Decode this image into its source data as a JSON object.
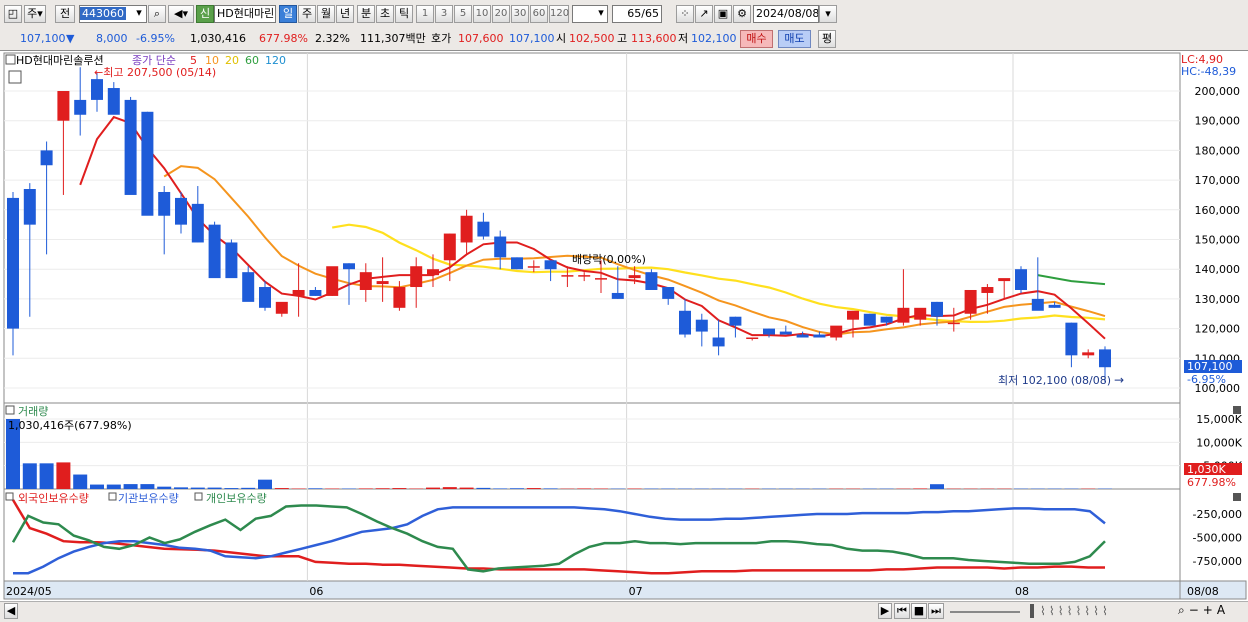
{
  "toolbar": {
    "market": "주",
    "prev_label": "전",
    "code": "443060",
    "name": "HD현대마린",
    "new_badge": "신",
    "periods": [
      "일",
      "주",
      "월",
      "년",
      "분",
      "초",
      "틱"
    ],
    "active_period": "일",
    "intervals": [
      "1",
      "3",
      "5",
      "10",
      "20",
      "30",
      "60",
      "120"
    ],
    "count": "65/65",
    "date": "2024/08/08"
  },
  "quote": {
    "price": "107,100",
    "price_arrow": "▼",
    "change": "8,000",
    "change_pct": "-6.95%",
    "volume": "1,030,416",
    "volume_ratio": "677.98%",
    "turnover_pct": "2.32%",
    "amount": "111,307백만",
    "ask_label": "호가",
    "ask": "107,600",
    "bid": "107,100",
    "open_label": "시",
    "open": "102,500",
    "high_label": "고",
    "high": "113,600",
    "low_label": "저",
    "low": "102,100",
    "buy_label": "매수",
    "sell_label": "매도",
    "eval_label": "평"
  },
  "price_panel": {
    "title": "HD현대마린솔루션",
    "ma_title": "종가 단순",
    "ma_periods": [
      "5",
      "10",
      "20",
      "60",
      "120"
    ],
    "ma_colors": {
      "5": "#e01e1e",
      "10": "#f5951e",
      "20": "#ffd51e",
      "60": "#2e9e3e",
      "120": "#1e8fd0"
    },
    "lc_label": "LC:4,90",
    "hc_label": "HC:-48,39",
    "yticks": [
      {
        "v": 200000,
        "t": "200,000"
      },
      {
        "v": 190000,
        "t": "190,000"
      },
      {
        "v": 180000,
        "t": "180,000"
      },
      {
        "v": 170000,
        "t": "170,000"
      },
      {
        "v": 160000,
        "t": "160,000"
      },
      {
        "v": 150000,
        "t": "150,000"
      },
      {
        "v": 140000,
        "t": "140,000"
      },
      {
        "v": 130000,
        "t": "130,000"
      },
      {
        "v": 120000,
        "t": "120,000"
      },
      {
        "v": 110000,
        "t": "110,000"
      },
      {
        "v": 100000,
        "t": "100,000"
      }
    ],
    "high_label": "최고 207,500 (05/14)",
    "low_label": "최저 102,100 (08/08)",
    "dividend_label": "배당락(0.00%)",
    "current_price": "107,100",
    "current_pct": "-6.95%"
  },
  "volume_panel": {
    "title": "거래량",
    "value_label": "1,030,416주(677.98%)",
    "yticks": [
      {
        "v": 15000,
        "t": "15,000K"
      },
      {
        "v": 10000,
        "t": "10,000K"
      },
      {
        "v": 5000,
        "t": "5,000K"
      }
    ],
    "current": "1,030K",
    "current_pct": "677.98%"
  },
  "holding_panel": {
    "legend": [
      {
        "label": "외국인보유수량",
        "color": "#e01e1e"
      },
      {
        "label": "기관보유수량",
        "color": "#2f5fd8"
      },
      {
        "label": "개인보유수량",
        "color": "#2e8a4e"
      }
    ],
    "yticks": [
      {
        "v": -250000,
        "t": "-250,000"
      },
      {
        "v": -500000,
        "t": "-500,000"
      },
      {
        "v": -750000,
        "t": "-750,000"
      }
    ]
  },
  "xaxis": {
    "labels": [
      {
        "i": 0,
        "t": "2024/05"
      },
      {
        "i": 18,
        "t": "06"
      },
      {
        "i": 37,
        "t": "07"
      },
      {
        "i": 60,
        "t": "08"
      }
    ],
    "right_label": "08/08"
  },
  "chart_data": {
    "type": "candlestick",
    "o": [
      164,
      167,
      180,
      190,
      197,
      204,
      201,
      197,
      193,
      166,
      164,
      162,
      155,
      149,
      139,
      134,
      125,
      131,
      133,
      131,
      142,
      133,
      135,
      127,
      134,
      138,
      143,
      149,
      156,
      151,
      144,
      141,
      143,
      138,
      138,
      137,
      132,
      137,
      139,
      134,
      126,
      123,
      117,
      124,
      117,
      120,
      119,
      118,
      118,
      117,
      123,
      125,
      124,
      122,
      123,
      129,
      122,
      125,
      132,
      136,
      140,
      130,
      128,
      122,
      111,
      113
    ],
    "h": [
      166,
      169,
      183,
      193,
      208,
      206,
      203,
      198,
      193,
      168,
      166,
      168,
      156,
      150,
      141,
      136,
      126,
      142,
      134,
      133,
      142,
      142,
      144,
      136,
      144,
      145,
      152,
      160,
      159,
      153,
      144,
      143,
      143,
      141,
      139,
      143,
      141,
      141,
      140,
      134,
      130,
      125,
      123,
      124,
      117,
      120,
      121,
      119,
      119,
      118,
      124,
      125,
      124,
      140,
      124,
      129,
      127,
      126,
      135,
      136,
      141,
      144,
      129,
      122,
      113,
      114
    ],
    "l": [
      111,
      124,
      145,
      165,
      185,
      193,
      198,
      195,
      164,
      145,
      152,
      149,
      147,
      139,
      134,
      126,
      124,
      124,
      131,
      131,
      128,
      129,
      129,
      126,
      127,
      134,
      136,
      145,
      150,
      140,
      140,
      139,
      136,
      134,
      136,
      132,
      130,
      135,
      138,
      128,
      117,
      114,
      111,
      117,
      116,
      117,
      118,
      117,
      117,
      116,
      117,
      121,
      121,
      121,
      121,
      121,
      119,
      123,
      125,
      130,
      132,
      128,
      127,
      107,
      110,
      102
    ],
    "c": [
      120,
      155,
      175,
      200,
      192,
      197,
      192,
      165,
      158,
      158,
      155,
      149,
      137,
      137,
      129,
      127,
      129,
      133,
      131,
      141,
      140,
      139,
      136,
      134,
      141,
      140,
      152,
      158,
      151,
      144,
      140,
      141,
      140,
      138,
      138,
      137,
      130,
      138,
      133,
      130,
      118,
      119,
      114,
      121,
      117,
      118,
      118,
      117,
      117,
      121,
      126,
      121,
      122,
      127,
      127,
      124,
      122,
      133,
      134,
      137,
      133,
      126,
      127,
      111,
      112,
      107
    ],
    "dates_shown": [
      "2024/05",
      "06",
      "07",
      "08"
    ],
    "volume_k": [
      15000,
      5500,
      5500,
      5700,
      3100,
      950,
      950,
      1050,
      1050,
      500,
      350,
      300,
      300,
      200,
      250,
      2000,
      200,
      100,
      150,
      100,
      100,
      120,
      160,
      200,
      100,
      300,
      400,
      300,
      240,
      120,
      160,
      200,
      130,
      80,
      120,
      100,
      80,
      100,
      90,
      90,
      80,
      80,
      80,
      80,
      80,
      80,
      80,
      80,
      80,
      80,
      80,
      80,
      80,
      80,
      120,
      1030,
      80,
      80,
      80,
      80,
      80,
      80,
      80,
      80,
      80,
      80,
      1030
    ],
    "foreign_k": [
      -100,
      -400,
      -460,
      -540,
      -550,
      -550,
      -560,
      -580,
      -600,
      -620,
      -625,
      -630,
      -640,
      -660,
      -680,
      -700,
      -700,
      -700,
      -760,
      -770,
      -780,
      -780,
      -790,
      -790,
      -800,
      -810,
      -820,
      -830,
      -830,
      -840,
      -840,
      -840,
      -840,
      -840,
      -840,
      -850,
      -860,
      -870,
      -880,
      -880,
      -870,
      -860,
      -860,
      -860,
      -850,
      -850,
      -850,
      -850,
      -850,
      -850,
      -850,
      -850,
      -840,
      -840,
      -830,
      -820,
      -820,
      -820,
      -820,
      -830,
      -820,
      -820,
      -810,
      -810,
      -820,
      -820
    ],
    "institution_k": [
      -880,
      -880,
      -810,
      -720,
      -650,
      -600,
      -560,
      -540,
      -540,
      -560,
      -580,
      -610,
      -620,
      -640,
      -700,
      -710,
      -720,
      -700,
      -660,
      -620,
      -580,
      -540,
      -490,
      -440,
      -420,
      -400,
      -360,
      -270,
      -200,
      -180,
      -180,
      -180,
      -180,
      -180,
      -180,
      -180,
      -180,
      -180,
      -190,
      -200,
      -220,
      -250,
      -280,
      -300,
      -310,
      -310,
      -310,
      -300,
      -300,
      -290,
      -280,
      -270,
      -260,
      -250,
      -250,
      -250,
      -240,
      -240,
      -240,
      -240,
      -230,
      -230,
      -220,
      -220,
      -210,
      -200,
      -190,
      -190,
      -200,
      -200,
      -200,
      -220,
      -350
    ],
    "individual_k": [
      -550,
      -270,
      -340,
      -360,
      -480,
      -530,
      -600,
      -620,
      -580,
      -500,
      -560,
      -520,
      -440,
      -370,
      -310,
      -420,
      -300,
      -270,
      -170,
      -160,
      -160,
      -170,
      -180,
      -250,
      -330,
      -400,
      -460,
      -540,
      -600,
      -620,
      -840,
      -860,
      -830,
      -820,
      -810,
      -800,
      -780,
      -680,
      -600,
      -560,
      -560,
      -540,
      -560,
      -560,
      -570,
      -560,
      -560,
      -560,
      -560,
      -560,
      -540,
      -540,
      -550,
      -570,
      -580,
      -620,
      -640,
      -640,
      -650,
      -680,
      -720,
      -720,
      -720,
      -740,
      -750,
      -760,
      -770,
      -780,
      -780,
      -780,
      -760,
      -700,
      -540
    ],
    "ylim": [
      95,
      210
    ]
  }
}
